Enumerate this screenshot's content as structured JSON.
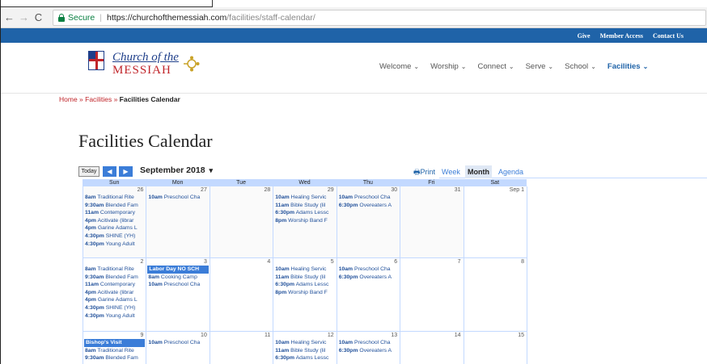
{
  "browser": {
    "secure_label": "Secure",
    "separator": "|",
    "url_host": "https://churchofthemessiah.com",
    "url_path": "/facilities/staff-calendar/",
    "back": "←",
    "forward": "→",
    "reload": "C"
  },
  "topbar": [
    "Give",
    "Member Access",
    "Contact Us"
  ],
  "logo": {
    "line1": "Church of the",
    "line2": "MESSIAH"
  },
  "menu": [
    {
      "label": "Welcome",
      "active": false
    },
    {
      "label": "Worship",
      "active": false
    },
    {
      "label": "Connect",
      "active": false
    },
    {
      "label": "Serve",
      "active": false
    },
    {
      "label": "School",
      "active": false
    },
    {
      "label": "Facilities",
      "active": true
    }
  ],
  "menu_chevron": "⌄",
  "breadcrumb": {
    "home": "Home",
    "sep": " » ",
    "section": "Facilities",
    "current": "Facilities Calendar"
  },
  "page_title": "Facilities Calendar",
  "calendar": {
    "today_label": "Today",
    "prev_label": "◀",
    "next_label": "▶",
    "month_label": "September 2018",
    "month_dropdown": "▾",
    "print_icon": "🖶",
    "print_label": "Print",
    "views": [
      "Week",
      "Month",
      "Agenda"
    ],
    "day_headers": [
      "Sun",
      "Mon",
      "Tue",
      "Wed",
      "Thu",
      "Fri",
      "Sat"
    ],
    "weeks": [
      {
        "days": [
          {
            "num": "26",
            "events": [
              [
                "8am",
                "Traditional Rite"
              ],
              [
                "9:30am",
                "Blended Fam"
              ],
              [
                "11am",
                "Contemporary"
              ],
              [
                "4pm",
                "Acitivate (librar"
              ],
              [
                "4pm",
                "Garine Adams L"
              ],
              [
                "4:30pm",
                "SHINE (YH)"
              ],
              [
                "4:30pm",
                "Young Adult"
              ]
            ]
          },
          {
            "num": "27",
            "events": [
              [
                "10am",
                "Preschool Cha"
              ]
            ]
          },
          {
            "num": "28",
            "events": []
          },
          {
            "num": "29",
            "events": [
              [
                "10am",
                "Healing Servic"
              ],
              [
                "11am",
                "Bible Study (lil"
              ],
              [
                "6:30pm",
                "Adams Lessc"
              ],
              [
                "8pm",
                "Worship Band F"
              ]
            ]
          },
          {
            "num": "30",
            "events": [
              [
                "10am",
                "Preschool Cha"
              ],
              [
                "6:30pm",
                "Overeaters A"
              ]
            ]
          },
          {
            "num": "31",
            "events": []
          },
          {
            "num": "Sep 1",
            "events": []
          }
        ]
      },
      {
        "days": [
          {
            "num": "2",
            "events": [
              [
                "8am",
                "Traditional Rite"
              ],
              [
                "9:30am",
                "Blended Fam"
              ],
              [
                "11am",
                "Contemporary"
              ],
              [
                "4pm",
                "Acitivate (librar"
              ],
              [
                "4pm",
                "Garine Adams L"
              ],
              [
                "4:30pm",
                "SHINE (YH)"
              ],
              [
                "4:30pm",
                "Young Adult"
              ]
            ]
          },
          {
            "num": "3",
            "allday": "Labor Day NO SCH",
            "events": [
              [
                "8am",
                "Cooking Camp"
              ],
              [
                "10am",
                "Preschool Cha"
              ]
            ]
          },
          {
            "num": "4",
            "events": []
          },
          {
            "num": "5",
            "events": [
              [
                "10am",
                "Healing Servic"
              ],
              [
                "11am",
                "Bible Study (lil"
              ],
              [
                "6:30pm",
                "Adams Lessc"
              ],
              [
                "8pm",
                "Worship Band F"
              ]
            ]
          },
          {
            "num": "6",
            "events": [
              [
                "10am",
                "Preschool Cha"
              ],
              [
                "6:30pm",
                "Overeaters A"
              ]
            ]
          },
          {
            "num": "7",
            "events": []
          },
          {
            "num": "8",
            "events": []
          }
        ]
      },
      {
        "days": [
          {
            "num": "9",
            "allday": "Bishop's Visit",
            "events": [
              [
                "8am",
                "Traditional Rite"
              ],
              [
                "9:30am",
                "Blended Fam"
              ]
            ]
          },
          {
            "num": "10",
            "events": [
              [
                "10am",
                "Preschool Cha"
              ]
            ]
          },
          {
            "num": "11",
            "events": []
          },
          {
            "num": "12",
            "events": [
              [
                "10am",
                "Healing Servic"
              ],
              [
                "11am",
                "Bible Study (lil"
              ],
              [
                "6:30pm",
                "Adams Lessc"
              ]
            ]
          },
          {
            "num": "13",
            "events": [
              [
                "10am",
                "Preschool Cha"
              ],
              [
                "6:30pm",
                "Overeaters A"
              ]
            ]
          },
          {
            "num": "14",
            "events": []
          },
          {
            "num": "15",
            "events": []
          }
        ]
      }
    ]
  },
  "colors": {
    "accent": "#1f63a8",
    "brand_red": "#c0252a",
    "calendar_header": "#c3d9ff",
    "event_blue": "#3b7dd8"
  }
}
